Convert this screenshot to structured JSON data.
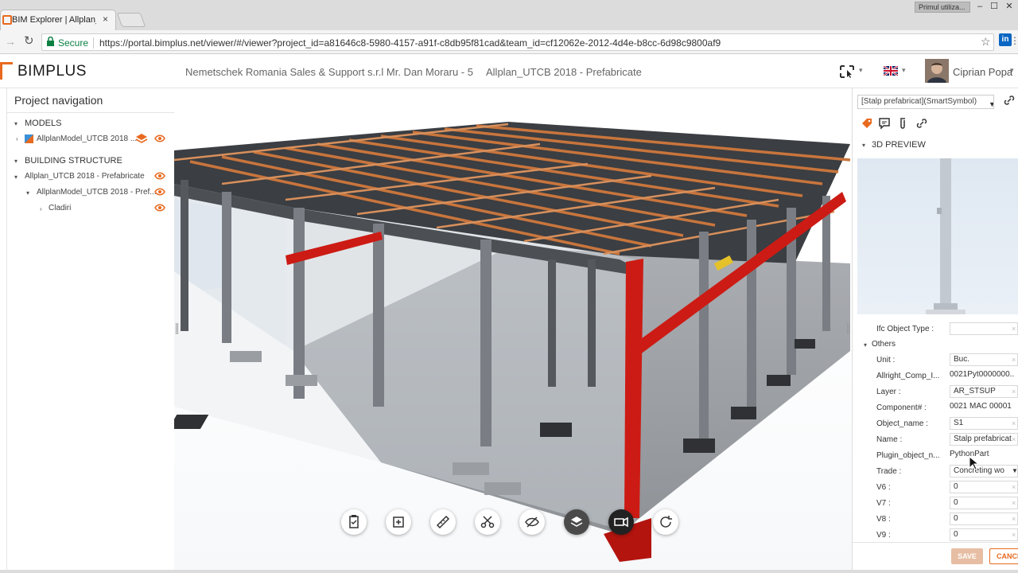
{
  "browser": {
    "tab_title": "BIM Explorer | Allplan_UTCB",
    "tab_close": "×",
    "user_chip": "Primul utiliza...",
    "window_min": "–",
    "window_max": "☐",
    "window_close": "✕",
    "secure_label": "Secure",
    "url": "https://portal.bimplus.net/viewer/#/viewer?project_id=a81646c8-5980-4157-a91f-c8db95f81cad&team_id=cf12062e-2012-4d4e-b8cc-6d98c9800af9",
    "linkedin_label": "in",
    "back_glyph": "→",
    "reload_glyph": "↻",
    "star_glyph": "☆",
    "menu_glyph": "⋮"
  },
  "header": {
    "logo_text": "BIMPLUS",
    "company": "Nemetschek Romania Sales & Support s.r.l Mr. Dan Moraru - 5",
    "project": "Allplan_UTCB 2018 - Prefabricate",
    "user_name": "Ciprian Popa",
    "caret": "▾"
  },
  "left_panel": {
    "title": "Project navigation",
    "models_section": "MODELS",
    "model_item": "AllplanModel_UTCB 2018 ...",
    "structure_section": "BUILDING STRUCTURE",
    "tree": [
      {
        "label": "Allplan_UTCB 2018 - Prefabricate"
      },
      {
        "label": "AllplanModel_UTCB 2018 - Pref..."
      },
      {
        "label": "Cladiri"
      }
    ],
    "expanded_glyph": "▾",
    "collapsed_glyph": "›"
  },
  "right_panel": {
    "selection": "[Stalp prefabricat](SmartSymbol)",
    "preview_label": "3D PREVIEW",
    "others_label": "Others",
    "ifc_label": "Ifc Object Type :",
    "properties": [
      {
        "label": "Unit :",
        "value": "Buc."
      },
      {
        "label": "Allright_Comp_I...",
        "value": "0021Pyt0000000..."
      },
      {
        "label": "Layer :",
        "value": "AR_STSUP"
      },
      {
        "label": "Component# :",
        "value": "0021 MAC 00001"
      },
      {
        "label": "Object_name :",
        "value": "S1"
      },
      {
        "label": "Name :",
        "value": "Stalp prefabricat"
      },
      {
        "label": "Plugin_object_n...",
        "value": "PythonPart"
      },
      {
        "label": "Trade :",
        "value": "Concreting wo"
      },
      {
        "label": "V6 :",
        "value": "0"
      },
      {
        "label": "V7 :",
        "value": "0"
      },
      {
        "label": "V8 :",
        "value": "0"
      },
      {
        "label": "V9 :",
        "value": "0"
      }
    ],
    "clear_glyph": "×",
    "save_label": "SAVE",
    "cancel_label": "CANCEL"
  },
  "toolbar": {
    "buttons": [
      "clipboard-icon",
      "crop-icon",
      "ruler-icon",
      "scissors-icon",
      "hide-icon",
      "layers-icon",
      "camera-icon",
      "rotate-icon"
    ]
  },
  "colors": {
    "accent": "#e86a1f",
    "beam_red": "#cc1b14",
    "purlin": "#c8753d"
  }
}
